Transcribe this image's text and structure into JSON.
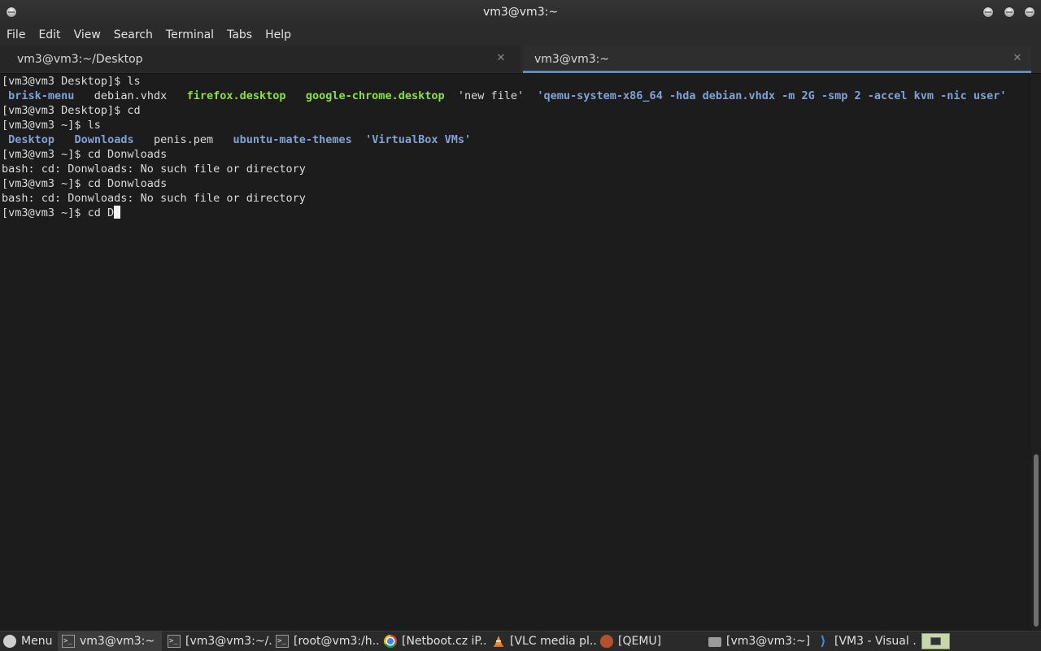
{
  "window": {
    "title": "vm3@vm3:~"
  },
  "menu": [
    "File",
    "Edit",
    "View",
    "Search",
    "Terminal",
    "Tabs",
    "Help"
  ],
  "tabs": [
    {
      "label": "vm3@vm3:~/Desktop",
      "active": false
    },
    {
      "label": "vm3@vm3:~",
      "active": true
    }
  ],
  "terminal": {
    "lines": [
      {
        "segs": [
          {
            "t": "[vm3@vm3 Desktop]$ ls",
            "c": ""
          }
        ]
      },
      {
        "segs": [
          {
            "t": " ",
            "c": ""
          },
          {
            "t": "brisk-menu",
            "c": "blue"
          },
          {
            "t": "   debian.vhdx   ",
            "c": ""
          },
          {
            "t": "firefox.desktop",
            "c": "green"
          },
          {
            "t": "   ",
            "c": ""
          },
          {
            "t": "google-chrome.desktop",
            "c": "green"
          },
          {
            "t": "  'new file'  ",
            "c": ""
          },
          {
            "t": "'qemu-system-x86_64 -hda debian.vhdx -m 2G -smp 2 -accel kvm -nic user'",
            "c": "blue"
          }
        ]
      },
      {
        "segs": [
          {
            "t": "[vm3@vm3 Desktop]$ cd",
            "c": ""
          }
        ]
      },
      {
        "segs": [
          {
            "t": "[vm3@vm3 ~]$ ls",
            "c": ""
          }
        ]
      },
      {
        "segs": [
          {
            "t": " ",
            "c": ""
          },
          {
            "t": "Desktop",
            "c": "blue"
          },
          {
            "t": "   ",
            "c": ""
          },
          {
            "t": "Downloads",
            "c": "blue"
          },
          {
            "t": "   penis.pem   ",
            "c": ""
          },
          {
            "t": "ubuntu-mate-themes",
            "c": "blue"
          },
          {
            "t": "  ",
            "c": ""
          },
          {
            "t": "'VirtualBox VMs'",
            "c": "blue"
          }
        ]
      },
      {
        "segs": [
          {
            "t": "[vm3@vm3 ~]$ cd Donwloads",
            "c": ""
          }
        ]
      },
      {
        "segs": [
          {
            "t": "bash: cd: Donwloads: No such file or directory",
            "c": ""
          }
        ]
      },
      {
        "segs": [
          {
            "t": "[vm3@vm3 ~]$ cd Donwloads",
            "c": ""
          }
        ]
      },
      {
        "segs": [
          {
            "t": "bash: cd: Donwloads: No such file or directory",
            "c": ""
          }
        ]
      },
      {
        "segs": [
          {
            "t": "[vm3@vm3 ~]$ cd D",
            "c": ""
          }
        ],
        "cursor": true
      }
    ]
  },
  "taskbar": {
    "menu_label": "Menu",
    "items": [
      {
        "label": "vm3@vm3:~",
        "icon": "terminal-icon",
        "active": true
      },
      {
        "label": "[vm3@vm3:~/...",
        "icon": "terminal-icon",
        "active": false
      },
      {
        "label": "[root@vm3:/h...",
        "icon": "terminal-icon",
        "active": false
      },
      {
        "label": "[Netboot.cz iP...",
        "icon": "chrome-icon",
        "active": false
      },
      {
        "label": "[VLC media pl...",
        "icon": "vlc-icon",
        "active": false
      },
      {
        "label": "[QEMU]",
        "icon": "qemu-icon",
        "active": false
      },
      {
        "label": "[vm3@vm3:~]",
        "icon": "folder-icon",
        "active": false
      },
      {
        "label": "[VM3 - Visual ...",
        "icon": "vscode-icon",
        "active": false
      }
    ]
  },
  "colors": {
    "dir_blue": "#7ea3d6",
    "exec_green": "#8ae234",
    "accent": "#4a90d9"
  }
}
